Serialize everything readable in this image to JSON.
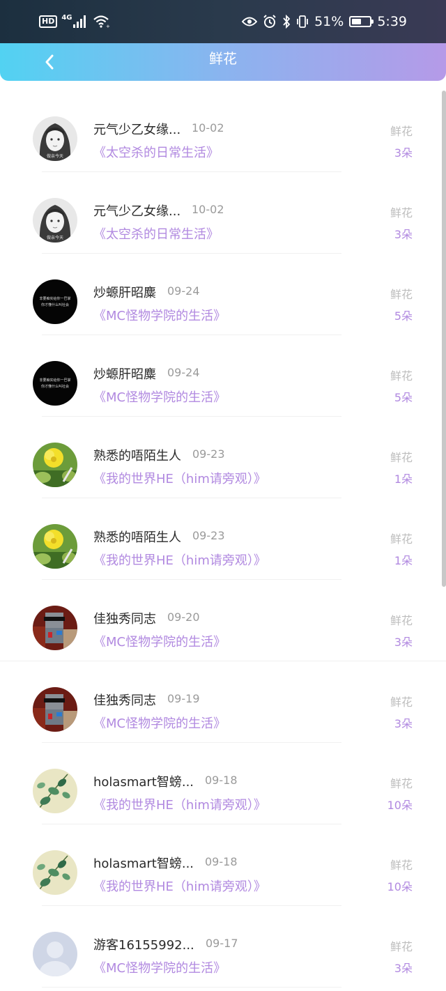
{
  "status_bar": {
    "hd": "HD",
    "network": "4G",
    "battery": "51%",
    "battery_level": 0.51,
    "time": "5:39"
  },
  "header": {
    "title": "鲜花"
  },
  "flower_label": "鲜花",
  "gifts": [
    {
      "name": "元气少乙女缘...",
      "date": "10-02",
      "book": "《太空杀的日常生活》",
      "count": "3朵",
      "avatar": "girl"
    },
    {
      "name": "元气少乙女缘...",
      "date": "10-02",
      "book": "《太空杀的日常生活》",
      "count": "3朵",
      "avatar": "girl"
    },
    {
      "name": "炒螈肝昭麋",
      "date": "09-24",
      "book": "《MC怪物学院的生活》",
      "count": "5朵",
      "avatar": "black-text"
    },
    {
      "name": "炒螈肝昭麋",
      "date": "09-24",
      "book": "《MC怪物学院的生活》",
      "count": "5朵",
      "avatar": "black-text"
    },
    {
      "name": "熟悉的唔陌生人",
      "date": "09-23",
      "book": "《我的世界HE（him请旁观）》",
      "count": "1朵",
      "avatar": "yellow-flower"
    },
    {
      "name": "熟悉的唔陌生人",
      "date": "09-23",
      "book": "《我的世界HE（him请旁观）》",
      "count": "1朵",
      "avatar": "yellow-flower"
    },
    {
      "name": "佳独秀同志",
      "date": "09-20",
      "book": "《MC怪物学院的生活》",
      "count": "3朵",
      "avatar": "pixel-character"
    },
    {
      "name": "佳独秀同志",
      "date": "09-19",
      "book": "《MC怪物学院的生活》",
      "count": "3朵",
      "avatar": "pixel-character"
    },
    {
      "name": "holasmart智螃...",
      "date": "09-18",
      "book": "《我的世界HE（him请旁观）》",
      "count": "10朵",
      "avatar": "plant"
    },
    {
      "name": "holasmart智螃...",
      "date": "09-18",
      "book": "《我的世界HE（him请旁观）》",
      "count": "10朵",
      "avatar": "plant"
    },
    {
      "name": "游客16155992...",
      "date": "09-17",
      "book": "《MC怪物学院的生活》",
      "count": "3朵",
      "avatar": "default-user"
    }
  ],
  "avatar_text": {
    "girl_watermark": "做亲今天",
    "black_text": "非要痴实给你一巴掌\n你才懂什么叫社会"
  }
}
